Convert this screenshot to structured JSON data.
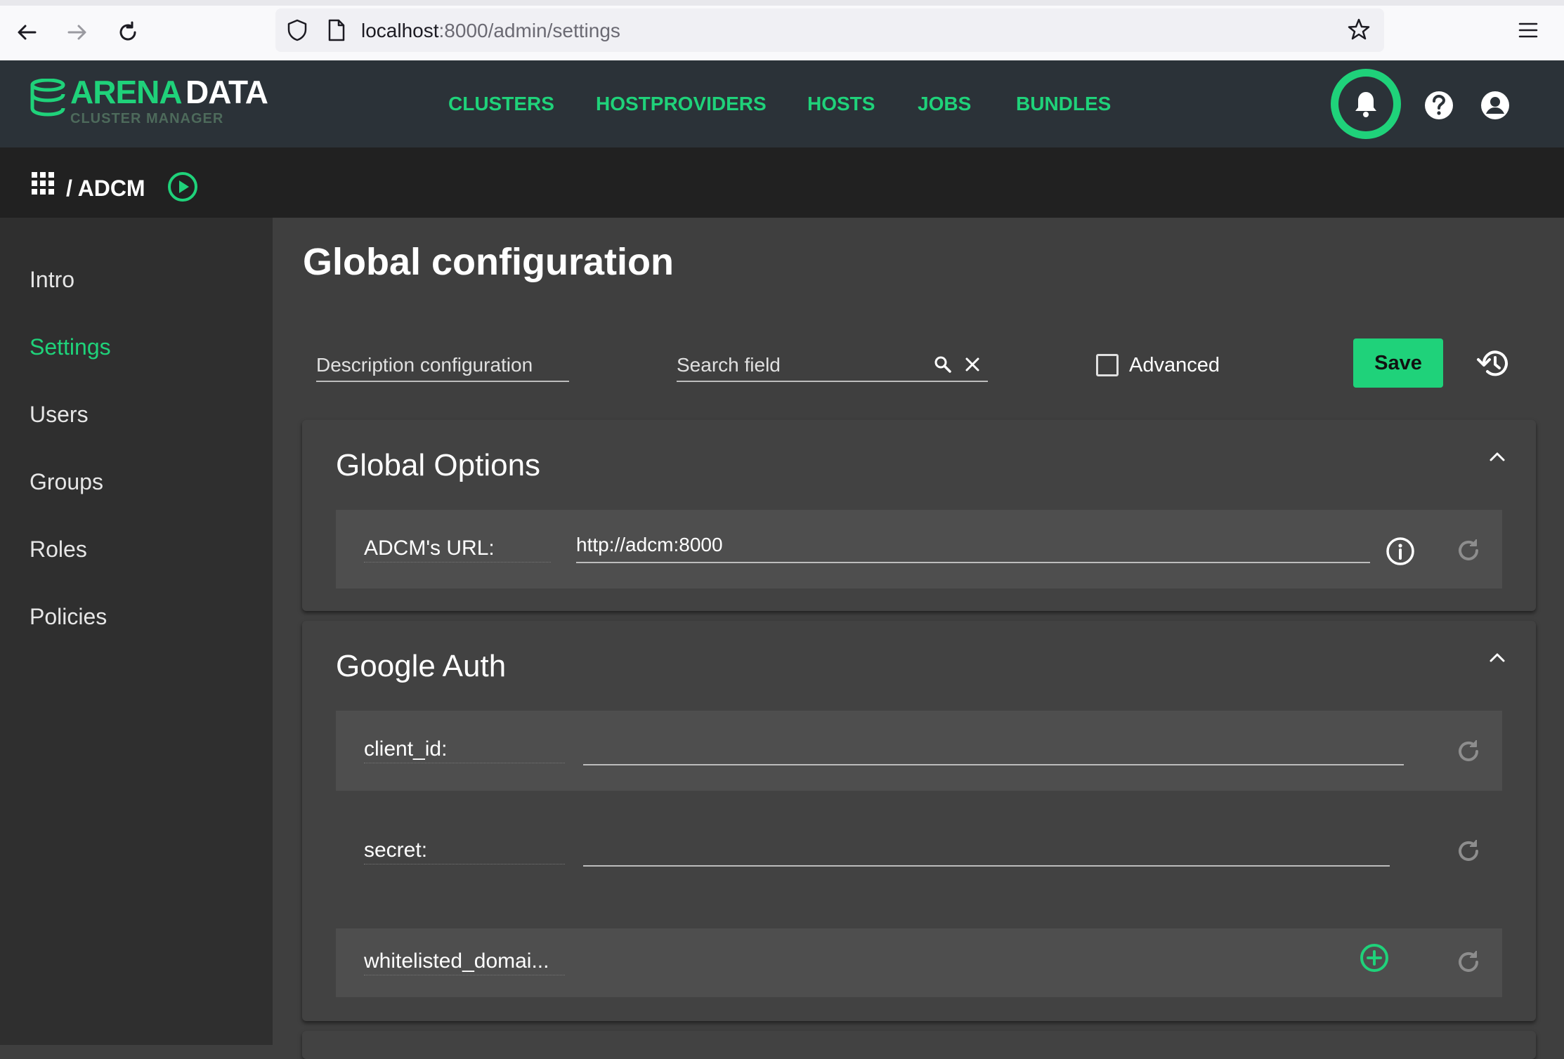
{
  "browser": {
    "url_host": "localhost",
    "url_path": ":8000/admin/settings"
  },
  "header": {
    "logo_arena": "ARENA",
    "logo_data": "DATA",
    "logo_sub": "CLUSTER MANAGER",
    "nav": [
      "CLUSTERS",
      "HOSTPROVIDERS",
      "HOSTS",
      "JOBS",
      "BUNDLES"
    ]
  },
  "breadcrumb": {
    "text": "/ ADCM"
  },
  "sidebar": {
    "items": [
      {
        "label": "Intro",
        "active": false
      },
      {
        "label": "Settings",
        "active": true
      },
      {
        "label": "Users",
        "active": false
      },
      {
        "label": "Groups",
        "active": false
      },
      {
        "label": "Roles",
        "active": false
      },
      {
        "label": "Policies",
        "active": false
      }
    ]
  },
  "main": {
    "title": "Global configuration",
    "toolbar": {
      "description_placeholder": "Description configuration",
      "search_placeholder": "Search field",
      "advanced_label": "Advanced",
      "advanced_checked": false,
      "save_label": "Save"
    },
    "sections": [
      {
        "title": "Global Options",
        "fields": [
          {
            "label": "ADCM's URL:",
            "value": "http://adcm:8000"
          }
        ]
      },
      {
        "title": "Google Auth",
        "fields": [
          {
            "label": "client_id:",
            "value": ""
          },
          {
            "label": "secret:",
            "value": ""
          },
          {
            "label": "whitelisted_domai...",
            "value": ""
          }
        ]
      }
    ]
  },
  "colors": {
    "accent": "#1fd27a",
    "header_bg": "#2b3238",
    "breadcrumb_bg": "#212121",
    "sidebar_bg": "#2f2f2f",
    "main_bg": "#3f3f3f",
    "panel_bg": "#424242",
    "row_bg": "#4e4e4e"
  },
  "icons": [
    "back-arrow-icon",
    "forward-arrow-icon",
    "reload-icon",
    "shield-icon",
    "page-icon",
    "star-icon",
    "hamburger-menu-icon",
    "bell-icon",
    "help-icon",
    "account-icon",
    "apps-grid-icon",
    "play-circle-icon",
    "search-icon",
    "clear-icon",
    "history-icon",
    "chevron-up-icon",
    "info-icon",
    "reset-icon",
    "add-circle-icon"
  ]
}
